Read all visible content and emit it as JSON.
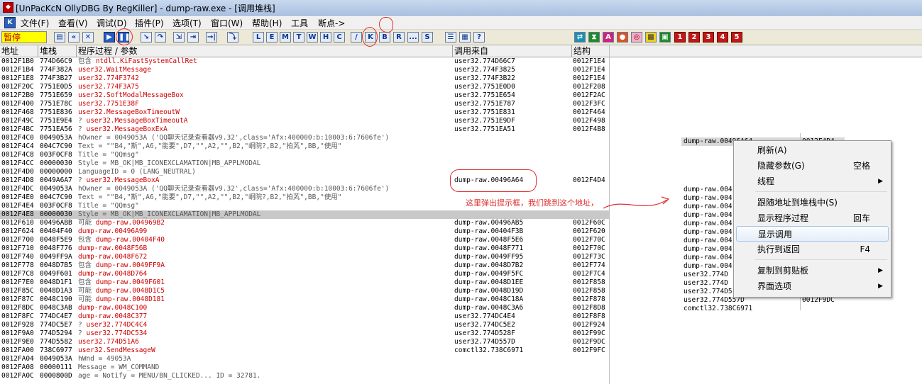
{
  "window": {
    "title": "[UnPacKcN OllyDBG By RegKiller] - dump-raw.exe - [调用堆栈]"
  },
  "menu": {
    "items": [
      "文件(F)",
      "查看(V)",
      "调试(D)",
      "插件(P)",
      "选项(T)",
      "窗口(W)",
      "帮助(H)",
      "工具",
      "断点->"
    ]
  },
  "toolbar": {
    "status": "暂停",
    "letters": [
      "L",
      "E",
      "M",
      "T",
      "W",
      "H",
      "C",
      "/",
      "K",
      "B",
      "R",
      "...",
      "S"
    ],
    "numbers": [
      "1",
      "2",
      "3",
      "4",
      "5"
    ]
  },
  "columns": {
    "address": "地址",
    "stack": "堆栈",
    "procedure": "程序过程 / 参数",
    "called_from": "调用来自",
    "frame": "结构"
  },
  "rows": [
    {
      "addr": "0012F1B0",
      "stack": "774D66C9",
      "prefix": "包含",
      "proc": "ntdll.KiFastSystemCallRet",
      "from": "user32.774D66C7",
      "frame": "0012F1E4",
      "style": "red"
    },
    {
      "addr": "0012F1B4",
      "stack": "774F382A",
      "prefix": "",
      "proc": "user32.WaitMessage",
      "from": "user32.774F3825",
      "frame": "0012F1E4",
      "style": "red"
    },
    {
      "addr": "0012F1E8",
      "stack": "774F3B27",
      "prefix": "",
      "proc": "user32.774F3742",
      "from": "user32.774F3B22",
      "frame": "0012F1E4",
      "style": "red"
    },
    {
      "addr": "0012F20C",
      "stack": "7751E0D5",
      "prefix": "",
      "proc": "user32.774F3A75",
      "from": "user32.7751E0D0",
      "frame": "0012F208",
      "style": "red"
    },
    {
      "addr": "0012F2B0",
      "stack": "7751E659",
      "prefix": "",
      "proc": "user32.SoftModalMessageBox",
      "from": "user32.7751E654",
      "frame": "0012F2AC",
      "style": "red"
    },
    {
      "addr": "0012F400",
      "stack": "7751E78C",
      "prefix": "",
      "proc": "user32.7751E38F",
      "from": "user32.7751E787",
      "frame": "0012F3FC",
      "style": "red"
    },
    {
      "addr": "0012F468",
      "stack": "7751E836",
      "prefix": "",
      "proc": "user32.MessageBoxTimeoutW",
      "from": "user32.7751E831",
      "frame": "0012F464",
      "style": "red"
    },
    {
      "addr": "0012F49C",
      "stack": "7751E9E4",
      "prefix": "?",
      "proc": "user32.MessageBoxTimeoutA",
      "from": "user32.7751E9DF",
      "frame": "0012F498",
      "style": "red"
    },
    {
      "addr": "0012F4BC",
      "stack": "7751EA56",
      "prefix": "?",
      "proc": "user32.MessageBoxExA",
      "from": "user32.7751EA51",
      "frame": "0012F4B8",
      "style": "red"
    },
    {
      "addr": "0012F4C0",
      "stack": "0049053A",
      "prefix": "",
      "proc": "  hOwner = 0049053A ('QQ聊天记录查看器v9.32',class='Afx:400000:b:10003:6:7606fe')",
      "from": "",
      "frame": "",
      "style": "gray"
    },
    {
      "addr": "0012F4C4",
      "stack": "004C7C90",
      "prefix": "",
      "proc": "  Text = \"\"B4,\"斯\",A6,\"能要\",D7,\"\",A2,\"\",B2,\"峒院?,B2,\"拍芄\",BB,\"使用\"",
      "from": "",
      "frame": "",
      "style": "gray"
    },
    {
      "addr": "0012F4C8",
      "stack": "003F0CF8",
      "prefix": "",
      "proc": "  Title = \"QQmsg\"",
      "from": "",
      "frame": "",
      "style": "gray"
    },
    {
      "addr": "0012F4CC",
      "stack": "00000030",
      "prefix": "",
      "proc": "  Style = MB_OK|MB_ICONEXCLAMATION|MB_APPLMODAL",
      "from": "",
      "frame": "",
      "style": "gray"
    },
    {
      "addr": "0012F4D0",
      "stack": "00000000",
      "prefix": "",
      "proc": "  LanguageID = 0 (LANG_NEUTRAL)",
      "from": "",
      "frame": "",
      "style": "gray"
    },
    {
      "addr": "0012F4D8",
      "stack": "0049A6A7",
      "prefix": "?",
      "proc": "user32.MessageBoxA",
      "from": "dump-raw.00496A64",
      "frame": "0012F4D4",
      "style": "red"
    },
    {
      "addr": "0012F4DC",
      "stack": "0049053A",
      "prefix": "",
      "proc": "  hOwner = 0049053A ('QQ聊天记录查看器v9.32',class='Afx:400000:b:10003:6:7606fe')",
      "from": "",
      "frame": "",
      "style": "gray"
    },
    {
      "addr": "0012F4E0",
      "stack": "004C7C90",
      "prefix": "",
      "proc": "  Text = \"\"B4,\"斯\",A6,\"能要\",D7,\"\",A2,\"\",B2,\"峒院?,B2,\"拍芄\",BB,\"使用\"",
      "from": "",
      "frame": "",
      "style": "gray"
    },
    {
      "addr": "0012F4E4",
      "stack": "003F0CF8",
      "prefix": "",
      "proc": "  Title = \"QQmsg\"",
      "from": "",
      "frame": "",
      "style": "gray"
    },
    {
      "addr": "0012F4E8",
      "stack": "00000030",
      "prefix": "",
      "proc": "  Style = MB_OK|MB_ICONEXCLAMATION|MB_APPLMODAL",
      "from": "",
      "frame": "",
      "style": "gray",
      "selected": true
    },
    {
      "addr": "0012F610",
      "stack": "00496ABB",
      "prefix": "可能",
      "proc": "dump-raw.004969B2",
      "from": "dump-raw.00496AB5",
      "frame": "0012F60C",
      "style": "red"
    },
    {
      "addr": "0012F624",
      "stack": "00404F40",
      "prefix": "",
      "proc": "dump-raw.00496A99",
      "from": "dump-raw.00404F3B",
      "frame": "0012F620",
      "style": "red"
    },
    {
      "addr": "0012F700",
      "stack": "0048F5E9",
      "prefix": "包含",
      "proc": "dump-raw.00404F40",
      "from": "dump-raw.0048F5E6",
      "frame": "0012F70C",
      "style": "red"
    },
    {
      "addr": "0012F710",
      "stack": "0048F776",
      "prefix": "",
      "proc": "dump-raw.0048F56B",
      "from": "dump-raw.0048F771",
      "frame": "0012F70C",
      "style": "red"
    },
    {
      "addr": "0012F740",
      "stack": "0049FF9A",
      "prefix": "",
      "proc": "dump-raw.0048F672",
      "from": "dump-raw.0049FF95",
      "frame": "0012F73C",
      "style": "red"
    },
    {
      "addr": "0012F778",
      "stack": "0048D7B5",
      "prefix": "包含",
      "proc": "dump-raw.0049FF9A",
      "from": "dump-raw.0048D7B2",
      "frame": "0012F774",
      "style": "red"
    },
    {
      "addr": "0012F7C8",
      "stack": "0049F601",
      "prefix": "",
      "proc": "dump-raw.0048D764",
      "from": "dump-raw.0049F5FC",
      "frame": "0012F7C4",
      "style": "red"
    },
    {
      "addr": "0012F7E0",
      "stack": "0048D1F1",
      "prefix": "包含",
      "proc": "dump-raw.0049F601",
      "from": "dump-raw.0048D1EE",
      "frame": "0012F858",
      "style": "red"
    },
    {
      "addr": "0012F85C",
      "stack": "0048D1A3",
      "prefix": "可能",
      "proc": "dump-raw.0048D1C5",
      "from": "dump-raw.0048D19D",
      "frame": "0012F858",
      "style": "red"
    },
    {
      "addr": "0012F87C",
      "stack": "0048C190",
      "prefix": "可能",
      "proc": "dump-raw.0048D181",
      "from": "dump-raw.0048C18A",
      "frame": "0012F878",
      "style": "red"
    },
    {
      "addr": "0012F8DC",
      "stack": "0048C3AB",
      "prefix": "",
      "proc": "dump-raw.0048C100",
      "from": "dump-raw.0048C3A6",
      "frame": "0012F8D8",
      "style": "red"
    },
    {
      "addr": "0012F8FC",
      "stack": "774DC4E7",
      "prefix": "",
      "proc": "dump-raw.0048C377",
      "from": "user32.774DC4E4",
      "frame": "0012F8F8",
      "style": "red"
    },
    {
      "addr": "0012F928",
      "stack": "774DC5E7",
      "prefix": "?",
      "proc": "user32.774DC4C4",
      "from": "user32.774DC5E2",
      "frame": "0012F924",
      "style": "red"
    },
    {
      "addr": "0012F9A0",
      "stack": "774D5294",
      "prefix": "?",
      "proc": "user32.774DC534",
      "from": "user32.774D528F",
      "frame": "0012F99C",
      "style": "red"
    },
    {
      "addr": "0012F9E0",
      "stack": "774D5582",
      "prefix": "",
      "proc": "user32.774D51A6",
      "from": "user32.774D557D",
      "frame": "0012F9DC",
      "style": "red"
    },
    {
      "addr": "0012FA00",
      "stack": "738C6977",
      "prefix": "",
      "proc": "user32.SendMessageW",
      "from": "comctl32.738C6971",
      "frame": "0012F9FC",
      "style": "red"
    },
    {
      "addr": "0012FA04",
      "stack": "0049053A",
      "prefix": "",
      "proc": "  hWnd = 49053A",
      "from": "",
      "frame": "",
      "style": "gray"
    },
    {
      "addr": "0012FA08",
      "stack": "00000111",
      "prefix": "",
      "proc": "  Message = WM_COMMAND",
      "from": "",
      "frame": "",
      "style": "gray"
    },
    {
      "addr": "0012FA0C",
      "stack": "0000800D",
      "prefix": "",
      "proc": "  age = Notify = MENU/BN_CLICKED... ID = 32781.",
      "from": "",
      "frame": "",
      "style": "gray"
    }
  ],
  "annotations": {
    "note": "这里弹出提示框，我们跳到这个地址，"
  },
  "right_pane": {
    "rows": [
      {
        "a": "dump-raw.00496A64",
        "b": "0012F4D4"
      },
      {
        "a": "dump-raw.004",
        "b": ""
      },
      {
        "a": "dump-raw.004",
        "b": ""
      },
      {
        "a": "dump-raw.004",
        "b": ""
      },
      {
        "a": "dump-raw.004",
        "b": ""
      },
      {
        "a": "dump-raw.004",
        "b": ""
      },
      {
        "a": "dump-raw.004",
        "b": ""
      },
      {
        "a": "dump-raw.004",
        "b": ""
      },
      {
        "a": "dump-raw.004",
        "b": ""
      },
      {
        "a": "dump-raw.004",
        "b": ""
      },
      {
        "a": "dump-raw.004",
        "b": ""
      },
      {
        "a": "user32.774D",
        "b": ""
      },
      {
        "a": "user32.774D",
        "b": ""
      },
      {
        "a": "user32.774D5",
        "b": ""
      },
      {
        "a": "user32.774D557D",
        "b": "0012F9DC"
      },
      {
        "a": "comctl32.738C6971",
        "b": ""
      }
    ]
  },
  "context_menu": {
    "items": [
      {
        "label": "刷新(A)",
        "key": "",
        "submenu": false
      },
      {
        "label": "隐藏参数(G)",
        "key": "空格",
        "submenu": false
      },
      {
        "label": "线程",
        "key": "",
        "submenu": true
      },
      {
        "label": "跟随地址到堆栈中(S)",
        "key": "",
        "submenu": false
      },
      {
        "label": "显示程序过程",
        "key": "回车",
        "submenu": false
      },
      {
        "label": "显示调用",
        "key": "",
        "submenu": false,
        "highlighted": true
      },
      {
        "label": "执行到返回",
        "key": "F4",
        "submenu": false
      },
      {
        "label": "复制到剪贴板",
        "key": "",
        "submenu": true
      },
      {
        "label": "界面选项",
        "key": "",
        "submenu": true
      }
    ]
  }
}
